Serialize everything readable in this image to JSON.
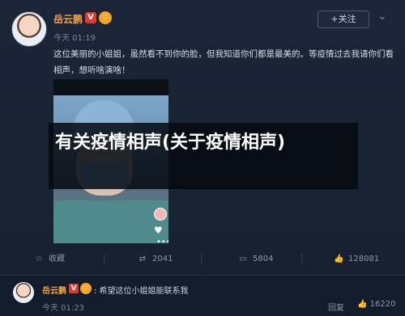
{
  "post": {
    "author": "岳云鹏",
    "verified_badge": "V",
    "fan_badge": "♡",
    "time": "今天 01:19",
    "follow_label": "+关注",
    "text": "这位美丽的小姐姐，虽然看不到你的脸，但我知道你们都是最美的。等疫情过去我请你们看相声，想听啥演啥！"
  },
  "overlay": {
    "title": "有关疫情相声(关于疫情相声)"
  },
  "actions": {
    "favorite": "收藏",
    "repost": "2041",
    "comment": "5804",
    "like": "128081"
  },
  "comment": {
    "author": "岳云鹏",
    "text": ": 希望这位小姐姐能联系我",
    "time": "今天 01:23",
    "reply": "回复",
    "likes": "16220"
  },
  "colors": {
    "accent": "#f0a24a",
    "background": "#16202f"
  }
}
